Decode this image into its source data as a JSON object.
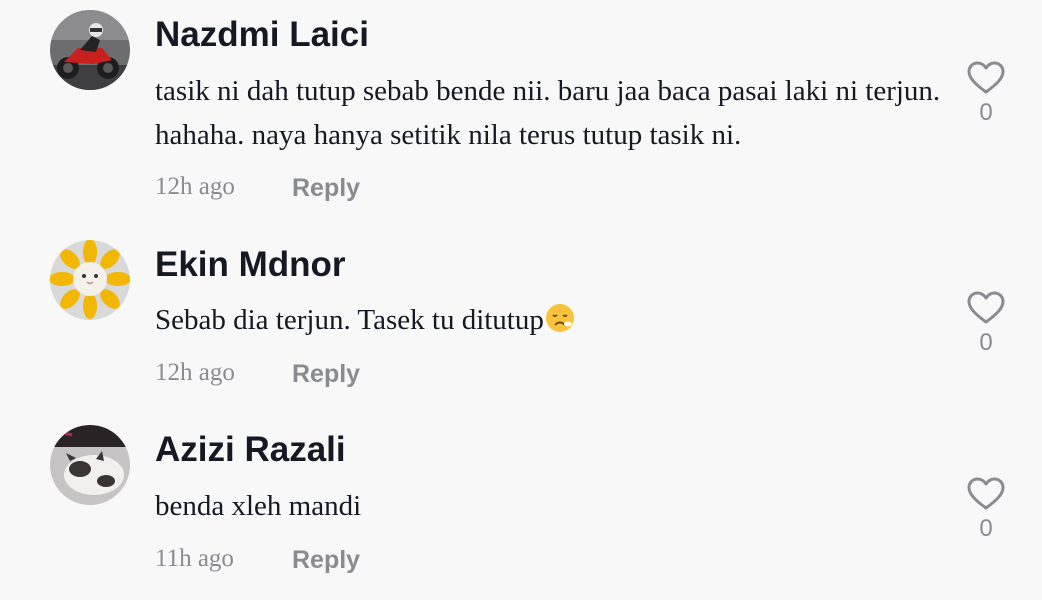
{
  "comments": [
    {
      "username": "Nazdmi Laici",
      "text": "tasik ni dah tutup sebab bende nii. baru jaa baca pasai laki ni terjun. hahaha. naya hanya setitik nila terus tutup tasik ni.",
      "time": "12h ago",
      "reply_label": "Reply",
      "likes": "0",
      "avatar_icon": "motorcycle-rider-avatar"
    },
    {
      "username": "Ekin Mdnor",
      "text": "Sebab dia terjun. Tasek tu ditutup",
      "emoji": "sad-sweat-emoji",
      "time": "12h ago",
      "reply_label": "Reply",
      "likes": "0",
      "avatar_icon": "sunflower-cat-avatar"
    },
    {
      "username": "Azizi Razali",
      "text": "benda xleh mandi",
      "time": "11h ago",
      "reply_label": "Reply",
      "likes": "0",
      "avatar_icon": "sleeping-cat-avatar"
    }
  ],
  "colors": {
    "background": "#f8f8f8",
    "name": "#161823",
    "muted": "#8a8b91"
  }
}
